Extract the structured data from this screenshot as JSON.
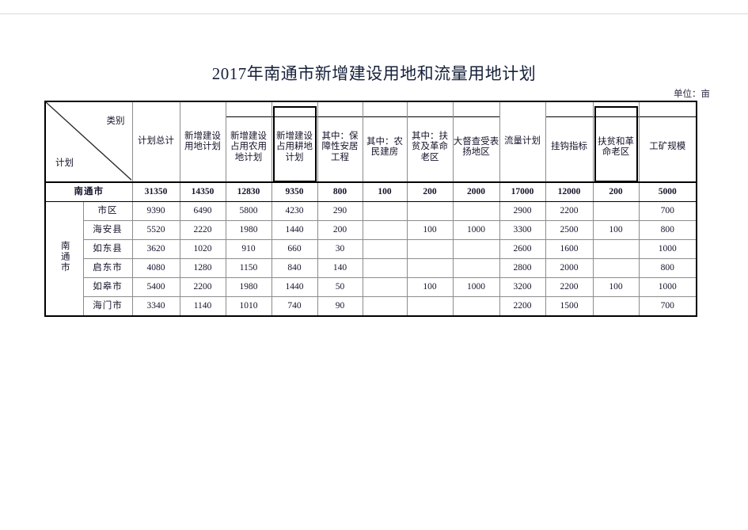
{
  "document": {
    "title": "2017年南通市新增建设用地和流量用地计划",
    "unit_note": "单位：亩"
  },
  "table": {
    "corner": {
      "category_label": "类别",
      "plan_label": "计划"
    },
    "group_label": "南通市",
    "columns": [
      {
        "key": "total",
        "label": "计划总计",
        "boxed": false
      },
      {
        "key": "new_constr",
        "label": "新增建设用地计划",
        "boxed": false
      },
      {
        "key": "farm_land",
        "label": "新增建设占用农用地计划",
        "boxed": false
      },
      {
        "key": "arable_land",
        "label": "新增建设占用耕地计划",
        "boxed": true
      },
      {
        "key": "housing",
        "label": "其中：保障性安居工程",
        "boxed": false
      },
      {
        "key": "farmer_house",
        "label": "其中：农民建房",
        "boxed": false
      },
      {
        "key": "poverty_old",
        "label": "其中：扶贫及革命老区",
        "boxed": false
      },
      {
        "key": "praised",
        "label": "大督查受表扬地区",
        "boxed": false
      },
      {
        "key": "flow_total",
        "label": "流量计划",
        "boxed": false
      },
      {
        "key": "linked",
        "label": "挂钩指标",
        "boxed": false
      },
      {
        "key": "poverty_old2",
        "label": "扶贫和革命老区",
        "boxed": true
      },
      {
        "key": "mining",
        "label": "工矿规模",
        "boxed": false
      }
    ],
    "rows": [
      {
        "name": "南通市",
        "is_total": true,
        "values": [
          "31350",
          "14350",
          "12830",
          "9350",
          "800",
          "100",
          "200",
          "2000",
          "17000",
          "12000",
          "200",
          "5000"
        ]
      },
      {
        "name": "市区",
        "is_total": false,
        "values": [
          "9390",
          "6490",
          "5800",
          "4230",
          "290",
          "",
          "",
          "",
          "2900",
          "2200",
          "",
          "700"
        ]
      },
      {
        "name": "海安县",
        "is_total": false,
        "values": [
          "5520",
          "2220",
          "1980",
          "1440",
          "200",
          "",
          "100",
          "1000",
          "3300",
          "2500",
          "100",
          "800"
        ]
      },
      {
        "name": "如东县",
        "is_total": false,
        "values": [
          "3620",
          "1020",
          "910",
          "660",
          "30",
          "",
          "",
          "",
          "2600",
          "1600",
          "",
          "1000"
        ]
      },
      {
        "name": "启东市",
        "is_total": false,
        "values": [
          "4080",
          "1280",
          "1150",
          "840",
          "140",
          "",
          "",
          "",
          "2800",
          "2000",
          "",
          "800"
        ]
      },
      {
        "name": "如皋市",
        "is_total": false,
        "values": [
          "5400",
          "2200",
          "1980",
          "1440",
          "50",
          "",
          "100",
          "1000",
          "3200",
          "2200",
          "100",
          "1000"
        ]
      },
      {
        "name": "海门市",
        "is_total": false,
        "values": [
          "3340",
          "1140",
          "1010",
          "740",
          "90",
          "",
          "",
          "",
          "2200",
          "1500",
          "",
          "700"
        ]
      }
    ]
  },
  "colors": {
    "text": "#14142b",
    "grid_light": "#bdbdbd",
    "grid_dark": "#000000",
    "page_rule": "#d9d9d9"
  }
}
